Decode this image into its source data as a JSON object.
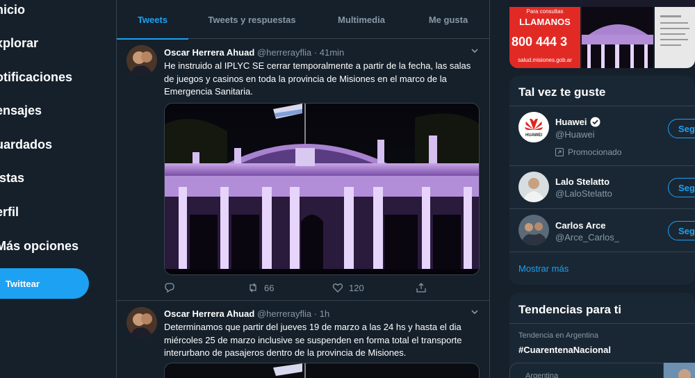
{
  "nav": {
    "items": [
      "nicio",
      "xplorar",
      "otificaciones",
      "ensajes",
      "uardados",
      "istas",
      "erfil",
      "Más opciones"
    ],
    "tweet_button": "Twittear"
  },
  "tabs": [
    "Tweets",
    "Tweets y respuestas",
    "Multimedia",
    "Me gusta"
  ],
  "tweets": [
    {
      "name": "Oscar Herrera Ahuad",
      "handle": "@herrerayflia",
      "time": "41min",
      "text": "He instruido al IPLYC SE cerrar temporalmente a partir de la fecha, las salas de juegos y casinos en toda la provincia de Misiones en el marco de la Emergencia Sanitaria.",
      "retweets": "66",
      "likes": "120"
    },
    {
      "name": "Oscar Herrera Ahuad",
      "handle": "@herrerayflia",
      "time": "1h",
      "text": "Determinamos que partir del jueves 19 de marzo a las 24 hs y hasta el dia miércoles 25 de marzo inclusive se suspenden en forma total el transporte interurbano de pasajeros  dentro de la provincia de Misiones."
    }
  ],
  "media_thumb": {
    "line1": "Para consultas",
    "line2": "LLAMANOS",
    "number": "800 444 3",
    "url": "salud.misiones.gob.ar"
  },
  "suggestions": {
    "title": "Tal vez te guste",
    "follow_label": "Seg",
    "promoted_label": "Promocionado",
    "more": "Mostrar más",
    "users": [
      {
        "name": "Huawei",
        "handle": "@Huawei",
        "avatar_text": "HUAWEI"
      },
      {
        "name": "Lalo Stelatto",
        "handle": "@LaloStelatto"
      },
      {
        "name": "Carlos Arce",
        "handle": "@Arce_Carlos_"
      }
    ]
  },
  "trends": {
    "title": "Tendencias para ti",
    "items": [
      {
        "meta": "Tendencia en Argentina",
        "name": "#CuarentenaNacional"
      },
      {
        "meta": "Argentina"
      }
    ]
  },
  "colors": {
    "accent": "#1da1f2",
    "bg": "#15202b",
    "panel": "#192734",
    "muted": "#8899a6"
  }
}
